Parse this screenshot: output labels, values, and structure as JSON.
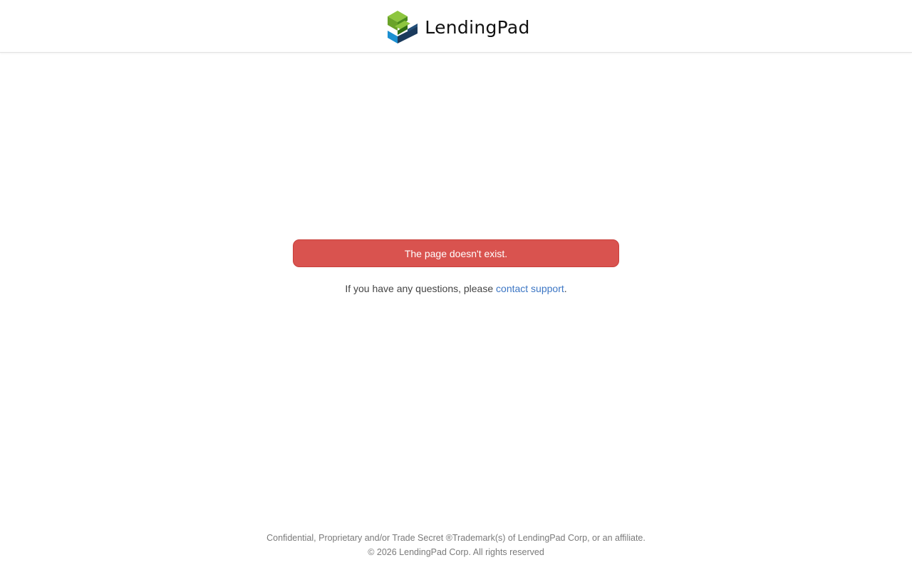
{
  "header": {
    "logo_text": "LendingPad",
    "logo_colors": {
      "green_light": "#8dc63f",
      "green_dark": "#4a8c1c",
      "blue": "#1b8fd1",
      "navy": "#1a3a5c"
    }
  },
  "alert": {
    "message": "The page doesn't exist.",
    "color": "#d9534f"
  },
  "help": {
    "prefix": "If you have any questions, please ",
    "link_text": "contact support",
    "suffix": "."
  },
  "footer": {
    "line1": "Confidential, Proprietary and/or Trade Secret ®Trademark(s) of LendingPad Corp, or an affiliate.",
    "line2": "© 2026 LendingPad Corp. All rights reserved"
  }
}
